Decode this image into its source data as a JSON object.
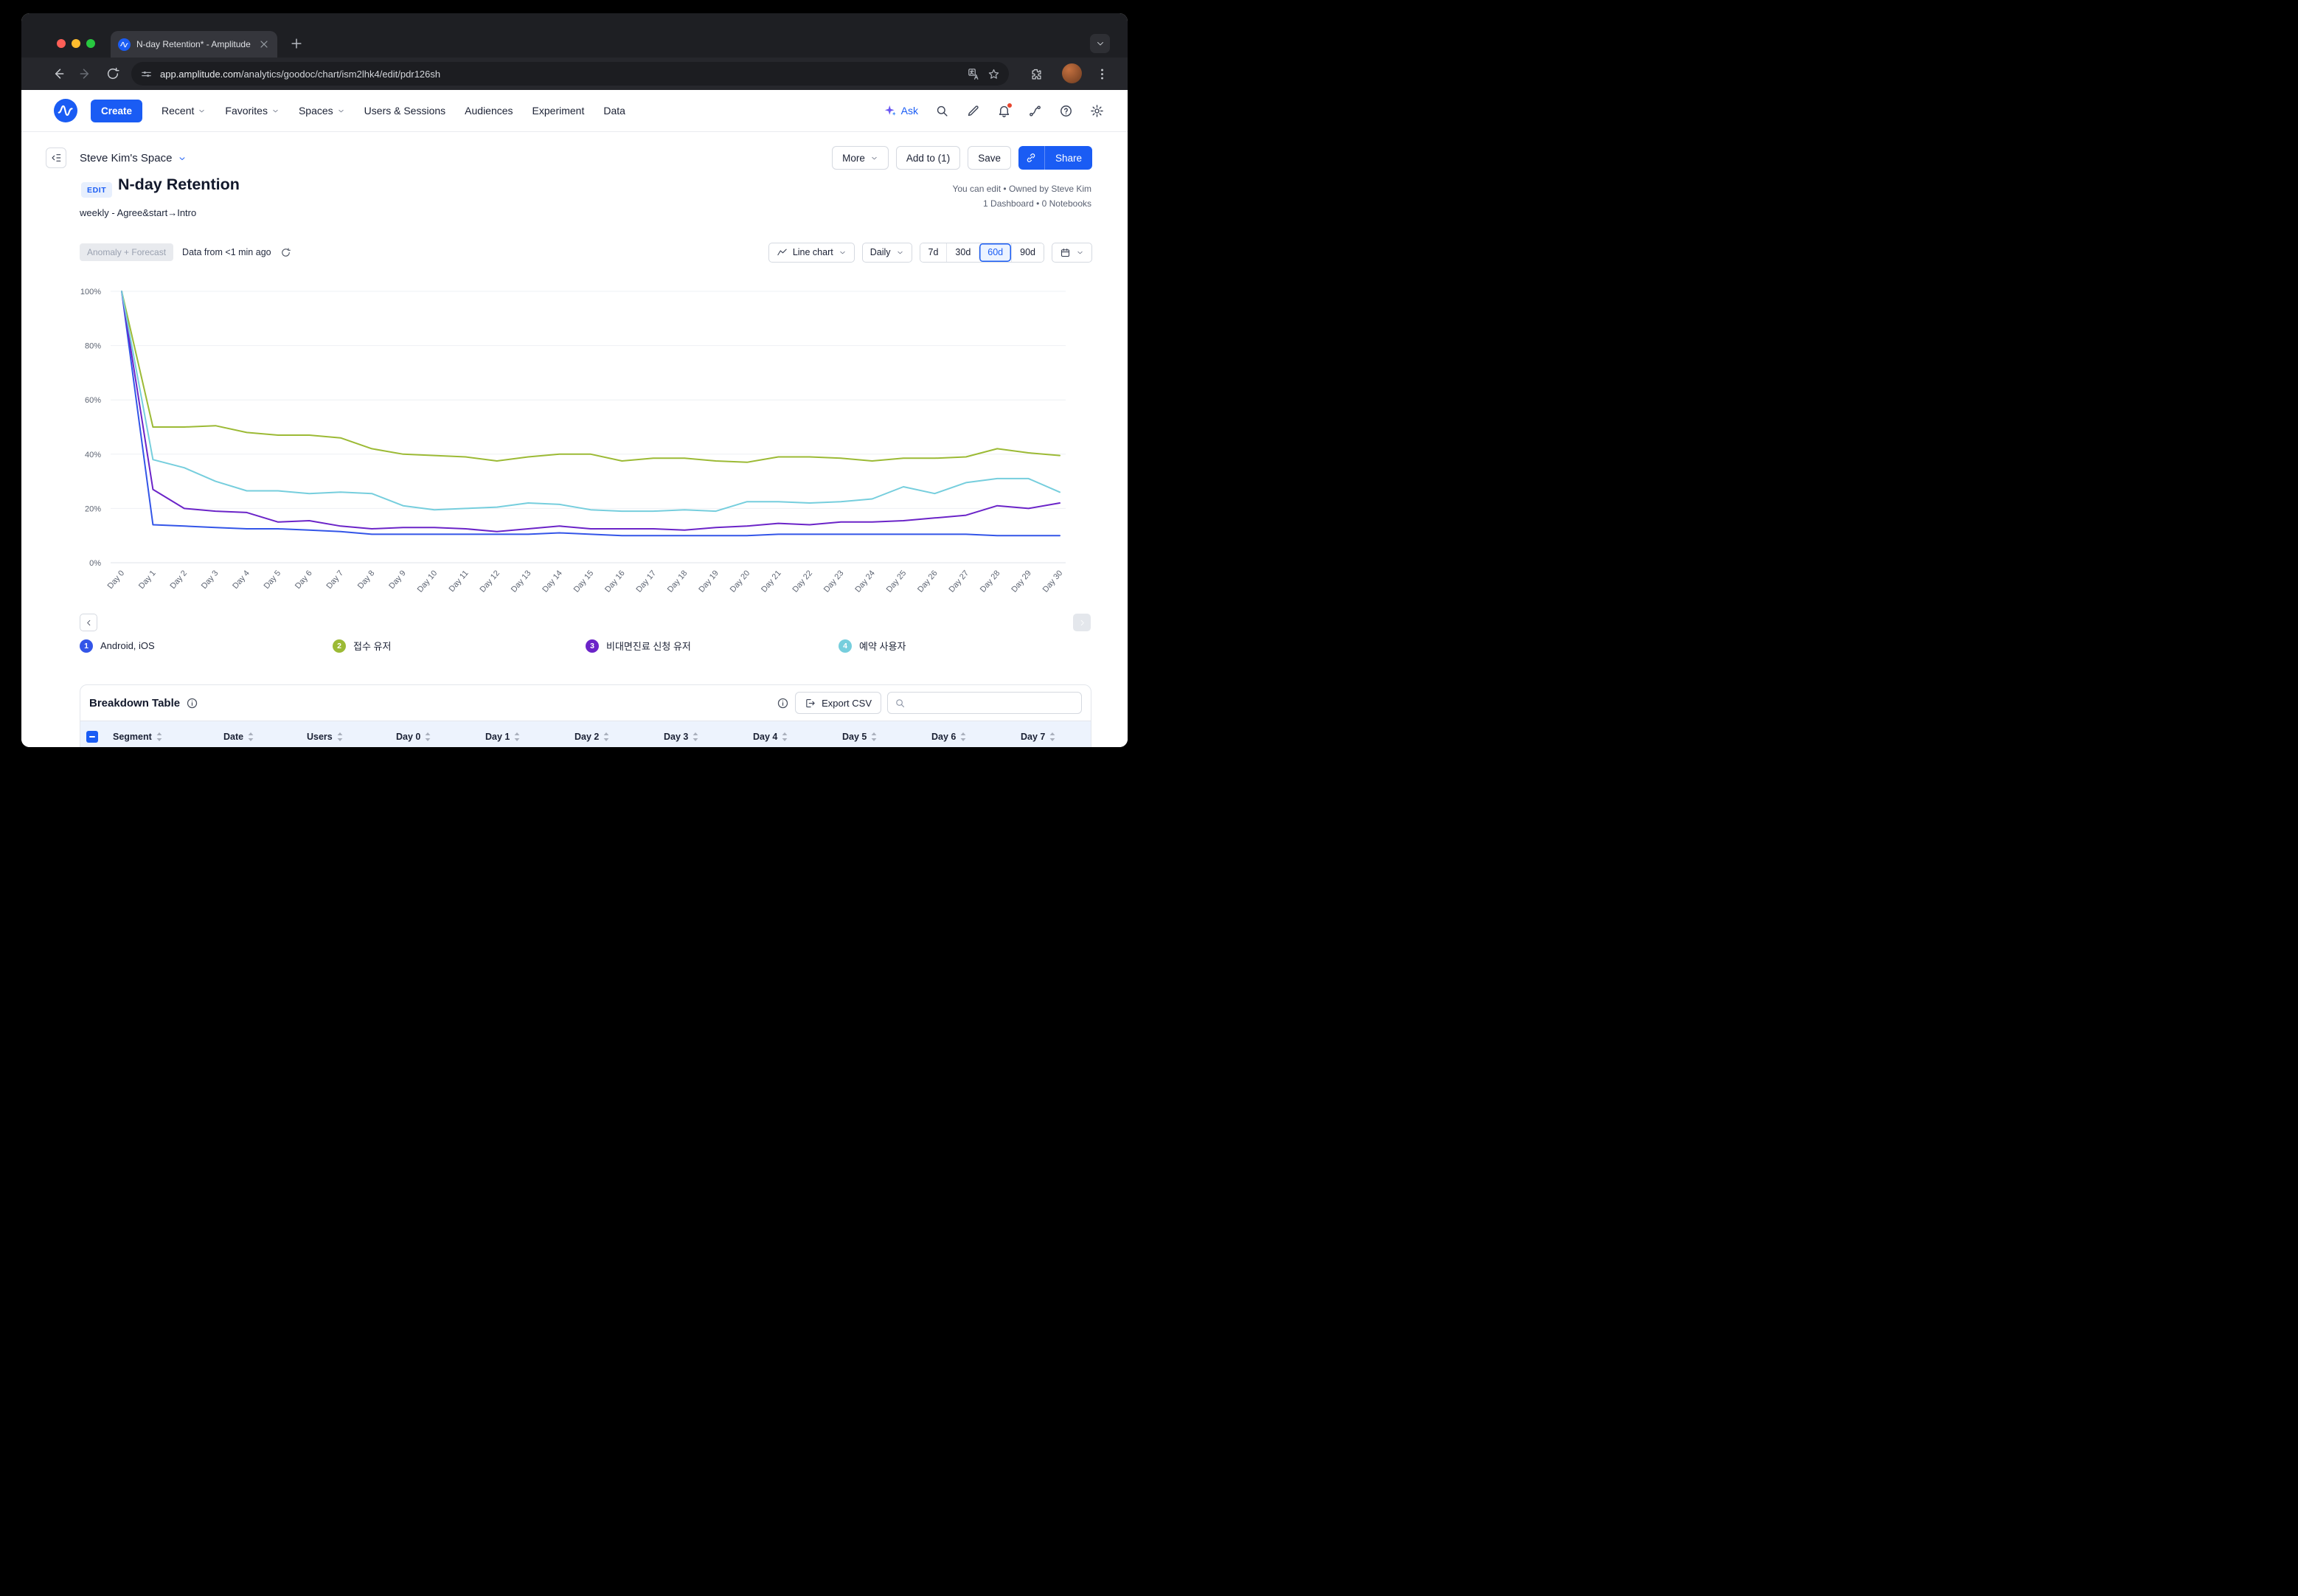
{
  "colors": {
    "accent": "#1a5cf4"
  },
  "browser": {
    "tab_title": "N-day Retention* - Amplitude",
    "url_domain": "app.amplitude.com",
    "url_path": "/analytics/goodoc/chart/ism2lhk4/edit/pdr126sh"
  },
  "nav": {
    "create": "Create",
    "items": [
      {
        "label": "Recent"
      },
      {
        "label": "Favorites"
      },
      {
        "label": "Spaces"
      },
      {
        "label": "Users & Sessions"
      },
      {
        "label": "Audiences"
      },
      {
        "label": "Experiment"
      },
      {
        "label": "Data"
      }
    ],
    "ask": "Ask"
  },
  "subheader": {
    "space": "Steve Kim's Space",
    "more": "More",
    "add_to": "Add to (1)",
    "save": "Save",
    "share": "Share"
  },
  "title_block": {
    "badge": "EDIT",
    "title": "N-day Retention",
    "subtitle": "weekly - Agree&start→Intro",
    "meta_edit": "You can edit • Owned by Steve Kim",
    "meta_counts": "1 Dashboard • 0 Notebooks"
  },
  "controls": {
    "anomaly": "Anomaly + Forecast",
    "freshness": "Data from <1 min ago",
    "chart_type": "Line chart",
    "granularity": "Daily",
    "ranges": [
      "7d",
      "30d",
      "60d",
      "90d"
    ],
    "selected_range": "60d"
  },
  "chart_data": {
    "type": "line",
    "title": "",
    "xlabel": "",
    "ylabel": "",
    "ylim": [
      0,
      100
    ],
    "grid": true,
    "legend_position": "bottom",
    "x_labels": [
      "Day 0",
      "Day 1",
      "Day 2",
      "Day 3",
      "Day 4",
      "Day 5",
      "Day 6",
      "Day 7",
      "Day 8",
      "Day 9",
      "Day 10",
      "Day 11",
      "Day 12",
      "Day 13",
      "Day 14",
      "Day 15",
      "Day 16",
      "Day 17",
      "Day 18",
      "Day 19",
      "Day 20",
      "Day 21",
      "Day 22",
      "Day 23",
      "Day 24",
      "Day 25",
      "Day 26",
      "Day 27",
      "Day 28",
      "Day 29",
      "Day 30"
    ],
    "y_ticks": [
      "0%",
      "20%",
      "40%",
      "60%",
      "80%",
      "100%"
    ],
    "series": [
      {
        "legend_num": "1",
        "name": "Android, iOS",
        "color": "#3355e8",
        "values": [
          100,
          14,
          13.5,
          13,
          12.5,
          12.5,
          12,
          11.5,
          10.5,
          10.5,
          10.5,
          10.5,
          10.5,
          10.5,
          11,
          10.5,
          10,
          10,
          10,
          10,
          10,
          10.5,
          10.5,
          10.5,
          10.5,
          10.5,
          10.5,
          10.5,
          10,
          10,
          10
        ]
      },
      {
        "legend_num": "2",
        "name": "접수 유저",
        "color": "#9cba35",
        "values": [
          100,
          50,
          50,
          50.5,
          48,
          47,
          47,
          46,
          42,
          40,
          39.5,
          39,
          37.5,
          39,
          40,
          40,
          37.5,
          38.5,
          38.5,
          37.5,
          37,
          39,
          39,
          38.5,
          37.5,
          38.5,
          38.5,
          39,
          42,
          40.5,
          39.5
        ]
      },
      {
        "legend_num": "3",
        "name": "비대면진료 신청 유저",
        "color": "#6b24c8",
        "values": [
          100,
          27,
          20,
          19,
          18.5,
          15,
          15.5,
          13.5,
          12.5,
          13,
          13,
          12.5,
          11.5,
          12.5,
          13.5,
          12.5,
          12.5,
          12.5,
          12,
          13,
          13.5,
          14.5,
          14,
          15,
          15,
          15.5,
          16.5,
          17.5,
          21,
          20,
          22
        ]
      },
      {
        "legend_num": "4",
        "name": "예약 사용자",
        "color": "#76cedd",
        "values": [
          100,
          38,
          35,
          30,
          26.5,
          26.5,
          25.5,
          26,
          25.5,
          21,
          19.5,
          20,
          20.5,
          22,
          21.5,
          19.5,
          19,
          19,
          19.5,
          19,
          22.5,
          22.5,
          22,
          22.5,
          23.5,
          28,
          25.5,
          29.5,
          31,
          31,
          26
        ]
      }
    ]
  },
  "breakdown": {
    "title": "Breakdown Table",
    "export": "Export CSV",
    "columns": [
      "Segment",
      "Date",
      "Users",
      "Day 0",
      "Day 1",
      "Day 2",
      "Day 3",
      "Day 4",
      "Day 5",
      "Day 6",
      "Day 7"
    ]
  }
}
